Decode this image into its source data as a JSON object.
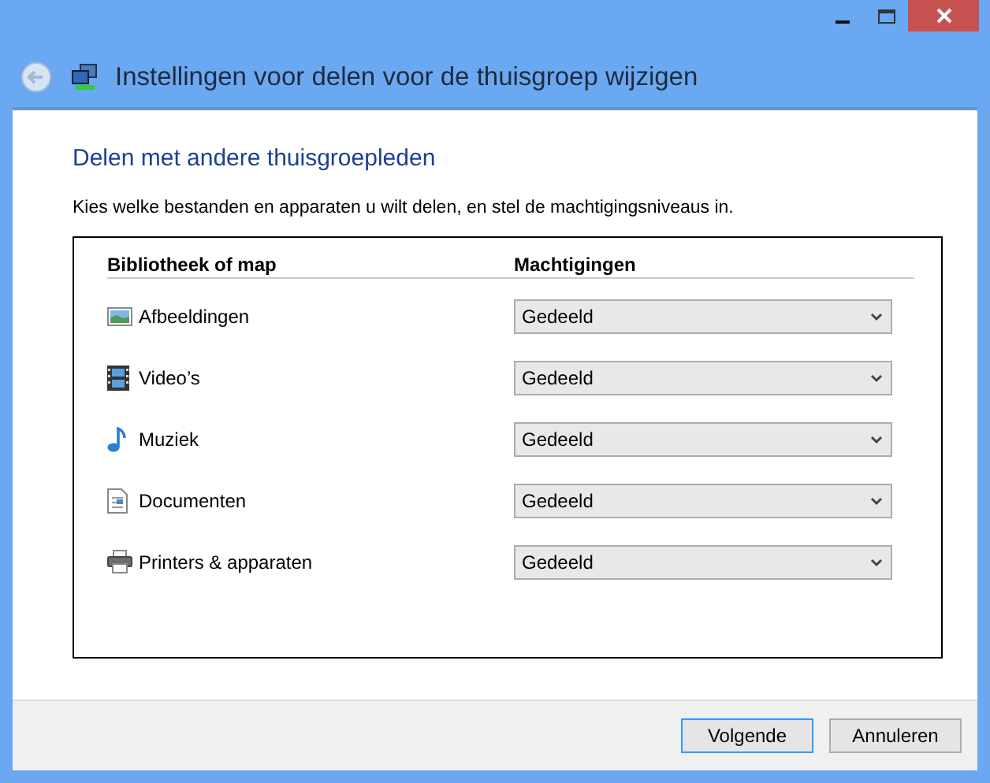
{
  "window": {
    "title": "Instellingen voor delen voor de thuisgroep wijzigen"
  },
  "heading": "Delen met andere thuisgroepleden",
  "intro": "Kies welke bestanden en apparaten u wilt delen, en stel de machtigingsniveaus in.",
  "table": {
    "columns": [
      "Bibliotheek of map",
      "Machtigingen"
    ],
    "rows": [
      {
        "kind": "pictures",
        "name": "Afbeeldingen",
        "permission": "Gedeeld"
      },
      {
        "kind": "videos",
        "name": "Video’s",
        "permission": "Gedeeld"
      },
      {
        "kind": "music",
        "name": "Muziek",
        "permission": "Gedeeld"
      },
      {
        "kind": "documents",
        "name": "Documenten",
        "permission": "Gedeeld"
      },
      {
        "kind": "printers",
        "name": "Printers & apparaten",
        "permission": "Gedeeld"
      }
    ]
  },
  "buttons": [
    {
      "label": "Volgende",
      "default": true
    },
    {
      "label": "Annuleren",
      "default": false
    }
  ]
}
